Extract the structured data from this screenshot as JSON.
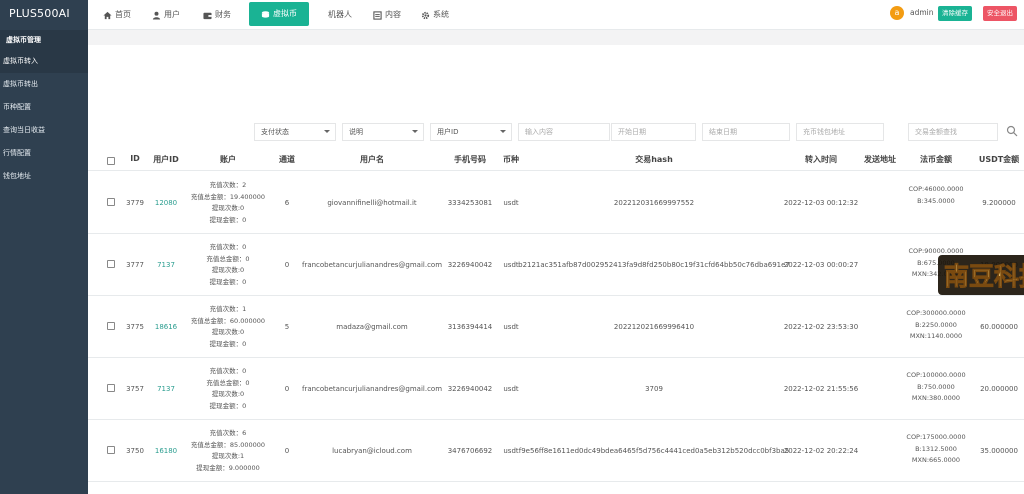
{
  "app": {
    "logo": "PLUS500AI"
  },
  "sidebar": {
    "section": "虚拟币管理",
    "items": [
      {
        "label": "虚拟币转入",
        "active": true
      },
      {
        "label": "虚拟币转出",
        "active": false
      },
      {
        "label": "币种配置",
        "active": false
      },
      {
        "label": "查询当日收益",
        "active": false
      },
      {
        "label": "行情配置",
        "active": false
      },
      {
        "label": "钱包地址",
        "active": false
      }
    ]
  },
  "topnav": {
    "items": [
      {
        "label": "首页",
        "icon": "home-icon"
      },
      {
        "label": "用户",
        "icon": "user-icon"
      },
      {
        "label": "财务",
        "icon": "wallet-icon"
      },
      {
        "label": "虚拟币",
        "icon": "coins-icon",
        "active": true
      },
      {
        "label": "机器人",
        "icon": ""
      },
      {
        "label": "内容",
        "icon": "document-icon"
      },
      {
        "label": "系统",
        "icon": "gear-icon"
      }
    ],
    "avatar_letter": "a",
    "admin_name": "admin",
    "clear_cache": "清除缓存",
    "logout": "安全退出"
  },
  "filters": {
    "payment_status": "支付状态",
    "description": "说明",
    "user_id": "用户ID",
    "keyword_placeholder": "输入内容",
    "start_date_placeholder": "开始日期",
    "end_date_placeholder": "结束日期",
    "wallet_placeholder": "充币钱包地址",
    "amount_placeholder": "交易金额查找"
  },
  "table": {
    "headers": [
      "ID",
      "用户ID",
      "账户",
      "通道",
      "用户名",
      "手机号码",
      "币种",
      "交易hash",
      "转入时间",
      "发送地址",
      "法币金额",
      "USDT金额"
    ],
    "rows": [
      {
        "id": "3779",
        "uid": "12080",
        "stats": [
          "充值次数：2",
          "充值总金额：19.400000",
          "提现次数:0",
          "提现金额：0"
        ],
        "channel": "6",
        "username": "giovannifinelli@hotmail.it",
        "phone": "3334253081",
        "coin": "usdt",
        "hash": "202212031669997552",
        "time": "2022-12-03 00:12:32",
        "fiat": [
          "COP:46000.0000",
          "B:345.0000",
          ""
        ],
        "usdt": "9.200000"
      },
      {
        "id": "3777",
        "uid": "7137",
        "stats": [
          "充值次数：0",
          "充值总金额：0",
          "提现次数:0",
          "提现金额：0"
        ],
        "channel": "0",
        "username": "francobetancurjulianandres@gmail.com",
        "phone": "3226940042",
        "coin": "usdt",
        "hash": "b2121ac351afb87d002952413fa9d8fd250b80c19f31cfd64bb50c76dba691e7",
        "time": "2022-12-03 00:00:27",
        "fiat": [
          "COP:90000.0000",
          "B:675.0000",
          "MXN:342.0000"
        ],
        "usdt": "18.000000"
      },
      {
        "id": "3775",
        "uid": "18616",
        "stats": [
          "充值次数：1",
          "充值总金额：60.000000",
          "提现次数:0",
          "提现金额：0"
        ],
        "channel": "5",
        "username": "madaza@gmail.com",
        "phone": "3136394414",
        "coin": "usdt",
        "hash": "202212021669996410",
        "time": "2022-12-02 23:53:30",
        "fiat": [
          "COP:300000.0000",
          "B:2250.0000",
          "MXN:1140.0000"
        ],
        "usdt": "60.000000"
      },
      {
        "id": "3757",
        "uid": "7137",
        "stats": [
          "充值次数：0",
          "充值总金额：0",
          "提现次数:0",
          "提现金额：0"
        ],
        "channel": "0",
        "username": "francobetancurjulianandres@gmail.com",
        "phone": "3226940042",
        "coin": "usdt",
        "hash": "3709",
        "time": "2022-12-02 21:55:56",
        "fiat": [
          "COP:100000.0000",
          "B:750.0000",
          "MXN:380.0000"
        ],
        "usdt": "20.000000"
      },
      {
        "id": "3750",
        "uid": "16180",
        "stats": [
          "充值次数：6",
          "充值总金额：85.000000",
          "提现次数:1",
          "提现金额：9.000000"
        ],
        "channel": "0",
        "username": "lucabryan@icloud.com",
        "phone": "3476706692",
        "coin": "usdt",
        "hash": "f9e56ff8e1611ed0dc49bdea6465f5d756c4441ced0a5eb312b520dcc0bf3ba5",
        "time": "2022-12-02 20:22:24",
        "fiat": [
          "COP:175000.0000",
          "B:1312.5000",
          "MXN:665.0000"
        ],
        "usdt": "35.000000"
      }
    ]
  },
  "watermark": {
    "text": "南豆科技"
  },
  "colors": {
    "sidebar": "#2f4050",
    "accent": "#1ab394",
    "danger": "#ed5565",
    "avatar": "#f39c12"
  }
}
